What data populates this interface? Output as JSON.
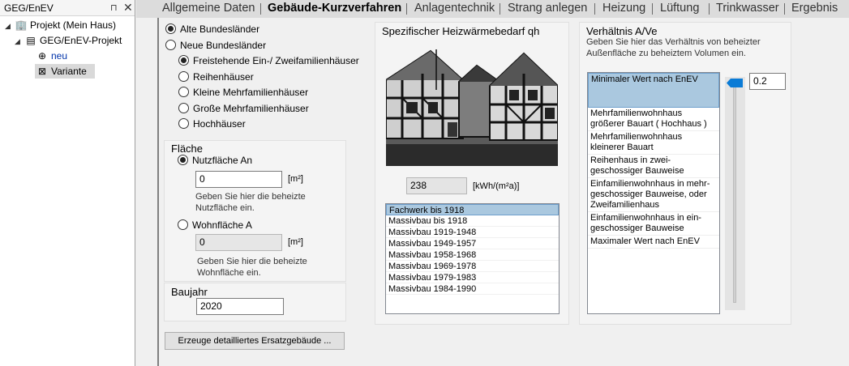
{
  "tree": {
    "header_title": "GEG/EnEV",
    "pin_icon": "pin-icon",
    "close_icon": "close-icon",
    "items": [
      {
        "label": "Projekt (Mein Haus)",
        "icon": "building-icon"
      },
      {
        "label": "GEG/EnEV-Projekt",
        "icon": "document-tree-icon"
      },
      {
        "label": "neu",
        "icon": "add-circle-icon"
      },
      {
        "label": "Variante",
        "icon": "variant-icon"
      }
    ]
  },
  "tabs": [
    {
      "label": "Allgemeine Daten"
    },
    {
      "label": "Gebäude-Kurzverfahren",
      "active": true
    },
    {
      "label": "Anlagentechnik"
    },
    {
      "label": "Strang anlegen"
    },
    {
      "label": "Heizung"
    },
    {
      "label": "Lüftung"
    },
    {
      "label": "Trinkwasser"
    },
    {
      "label": "Ergebnis"
    }
  ],
  "region": {
    "options": [
      {
        "label": "Alte Bundesländer",
        "checked": true
      },
      {
        "label": "Neue Bundesländer",
        "checked": false
      }
    ],
    "building_types": [
      {
        "label": "Freistehende Ein-/ Zweifamilienhäuser",
        "checked": true
      },
      {
        "label": "Reihenhäuser",
        "checked": false
      },
      {
        "label": "Kleine Mehrfamilienhäuser",
        "checked": false
      },
      {
        "label": "Große Mehrfamilienhäuser",
        "checked": false
      },
      {
        "label": "Hochhäuser",
        "checked": false
      }
    ]
  },
  "flaeche": {
    "title": "Fläche",
    "nutzflaeche_label": "Nutzfläche An",
    "nutzflaeche_value": "0",
    "nutzflaeche_unit": "[m²]",
    "nutzflaeche_hint": "Geben Sie hier die beheizte Nutzfläche ein.",
    "wohnflaeche_label": "Wohnfläche A",
    "wohnflaeche_value": "0",
    "wohnflaeche_unit": "[m²]",
    "wohnflaeche_hint": "Geben Sie hier die beheizte Wohnfläche ein."
  },
  "baujahr": {
    "title": "Baujahr",
    "value": "2020"
  },
  "ersatz_button": "Erzeuge detailliertes Ersatzgebäude ...",
  "heizwaerme": {
    "title": "Spezifischer Heizwärmebedarf qh",
    "value": "238",
    "unit": "[kWh/(m²a)]",
    "list": [
      {
        "label": "Fachwerk bis 1918",
        "selected": true
      },
      {
        "label": "Massivbau bis 1918"
      },
      {
        "label": "Massivbau 1919-1948"
      },
      {
        "label": "Massivbau 1949-1957"
      },
      {
        "label": "Massivbau 1958-1968"
      },
      {
        "label": "Massivbau 1969-1978"
      },
      {
        "label": "Massivbau 1979-1983"
      },
      {
        "label": "Massivbau 1984-1990"
      }
    ]
  },
  "verhaeltnis": {
    "title": "Verhältnis A/Ve",
    "description": "Geben Sie hier das Verhältnis von beheizter Außenfläche zu beheiztem Volumen ein.",
    "value": "0.2",
    "slider_level": 1.0,
    "list": [
      {
        "label": "Minimaler Wert nach EnEV",
        "selected": true
      },
      {
        "label": "Mehrfamilienwohnhaus größerer Bauart ( Hochhaus )"
      },
      {
        "label": "Mehrfamilienwohnhaus kleinerer Bauart"
      },
      {
        "label": "Reihenhaus in zwei-geschossiger Bauweise"
      },
      {
        "label": "Einfamilienwohnhaus in mehr-geschossiger Bauweise, oder Zweifamilienhaus"
      },
      {
        "label": "Einfamilienwohnhaus in ein-geschossiger Bauweise"
      },
      {
        "label": "Maximaler Wert nach EnEV"
      }
    ]
  }
}
